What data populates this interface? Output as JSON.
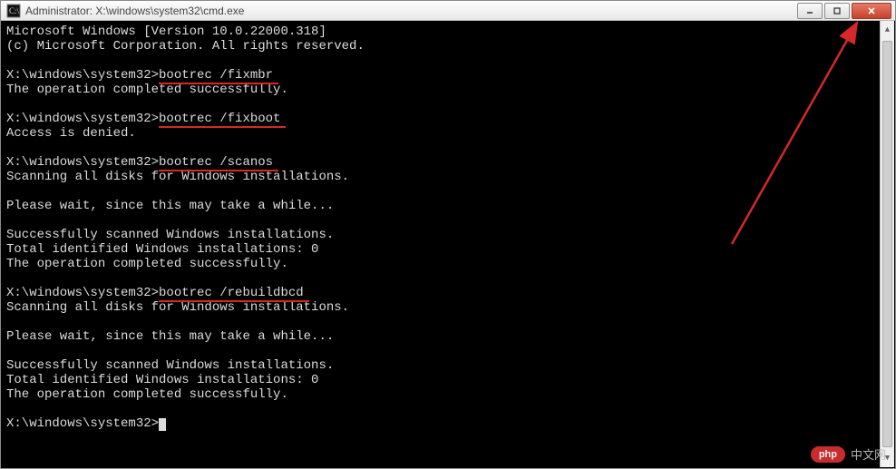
{
  "window": {
    "title": "Administrator: X:\\windows\\system32\\cmd.exe"
  },
  "terminal": {
    "banner1": "Microsoft Windows [Version 10.0.22000.318]",
    "banner2": "(c) Microsoft Corporation. All rights reserved.",
    "prompt": "X:\\windows\\system32>",
    "blocks": [
      {
        "command": "bootrec /fixmbr",
        "output": [
          "The operation completed successfully."
        ]
      },
      {
        "command": "bootrec /fixboot",
        "output": [
          "Access is denied."
        ]
      },
      {
        "command": "bootrec /scanos",
        "output": [
          "Scanning all disks for Windows installations.",
          "",
          "Please wait, since this may take a while...",
          "",
          "Successfully scanned Windows installations.",
          "Total identified Windows installations: 0",
          "The operation completed successfully."
        ]
      },
      {
        "command": "bootrec /rebuildbcd",
        "output": [
          "Scanning all disks for Windows installations.",
          "",
          "Please wait, since this may take a while...",
          "",
          "Successfully scanned Windows installations.",
          "Total identified Windows installations: 0",
          "The operation completed successfully."
        ]
      }
    ]
  },
  "watermark": {
    "badge": "php",
    "label": "中文网"
  }
}
